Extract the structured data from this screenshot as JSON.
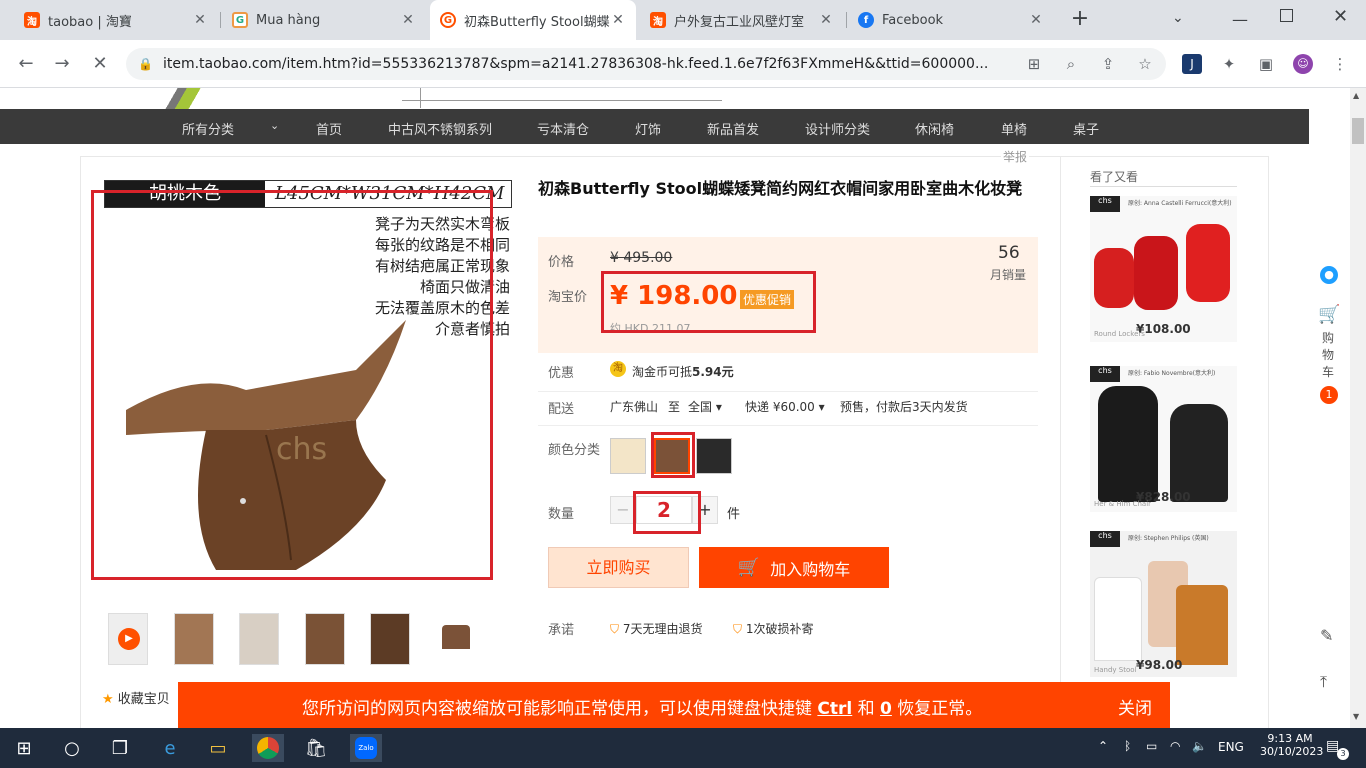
{
  "tabs": [
    {
      "title": "taobao | 淘寶",
      "color": "#ff5000",
      "icon": "taobao-icon",
      "glyph": "淘"
    },
    {
      "title": "Mua hàng",
      "color": "#ff6a6a",
      "icon": "muahang-icon",
      "glyph": "G"
    },
    {
      "title": "初森Butterfly Stool蝴蝶",
      "color": "#ff5000",
      "icon": "taobao-active-icon",
      "glyph": "G"
    },
    {
      "title": "户外复古工业风壁灯室",
      "color": "#ff5000",
      "icon": "taobao-icon",
      "glyph": "淘"
    },
    {
      "title": "Facebook",
      "color": "#1877f2",
      "icon": "facebook-icon",
      "glyph": "f"
    }
  ],
  "url": "item.taobao.com/item.htm?id=555336213787&spm=a2141.27836308-hk.feed.1.6e7f2f63FXmmeH&&ttid=600000...",
  "nav": [
    "所有分类",
    "首页",
    "中古风不锈钢系列",
    "亏本清仓",
    "灯饰",
    "新品首发",
    "设计师分类",
    "休闲椅",
    "单椅",
    "桌子"
  ],
  "report": "举报",
  "image_caption": {
    "color_label": "胡桃木色",
    "size": "L45CM*W31CM*H42CM",
    "notes": [
      "凳子为天然实木弯板",
      "每张的纹路是不相同",
      "有树结疤属正常现象",
      "椅面只做清油",
      "无法覆盖原木的色差",
      "介意者慎拍"
    ],
    "brand": "chs"
  },
  "title": "初森Butterfly Stool蝴蝶矮凳简约网红衣帽间家用卧室曲木化妆凳",
  "price": {
    "label": "价格",
    "original": "¥ 495.00",
    "tb_label": "淘宝价",
    "current": "¥ 198.00",
    "promo": "优惠促销",
    "hkd": "约 HKD 211.07",
    "sales_count": "56",
    "sales_label": "月销量"
  },
  "discount": {
    "label": "优惠",
    "text": "淘金币可抵",
    "amount": "5.94元"
  },
  "shipping": {
    "label": "配送",
    "from": "广东佛山",
    "to_word": "至",
    "region": "全国",
    "express": "快递 ¥60.00",
    "note": "预售，付款后3天内发货"
  },
  "color": {
    "label": "颜色分类"
  },
  "quantity": {
    "label": "数量",
    "value": "2",
    "unit": "件",
    "minus": "−",
    "plus": "+"
  },
  "buttons": {
    "buy": "立即购买",
    "cart": "加入购物车"
  },
  "promise": {
    "label": "承诺",
    "items": [
      "7天无理由退货",
      "1次破损补寄"
    ]
  },
  "favorite": "收藏宝贝",
  "related": {
    "heading": "看了又看",
    "items": [
      {
        "designer": "原创: Anna Castelli Ferrucci(意大利)",
        "price": "¥108.00",
        "name": "Round Lockers"
      },
      {
        "designer": "原创: Fabio Novembre(意大利)",
        "price": "¥828.00",
        "name": "Her & Him Chair"
      },
      {
        "designer": "原创: Stephen Philips (英国)",
        "price": "¥98.00",
        "name": "Handy Stool"
      }
    ]
  },
  "sidebar": {
    "cart_label": "购物车",
    "cart_count": "1"
  },
  "notice": {
    "pre": "您所访问的网页内容被缩放可能影响正常使用，可以使用键盘快捷键",
    "k1": "Ctrl",
    "and": "和",
    "k2": "0",
    "post": "恢复正常。",
    "close": "关闭"
  },
  "taskbar": {
    "lang": "ENG",
    "time": "9:13 AM",
    "date": "30/10/2023",
    "notif": "3"
  }
}
